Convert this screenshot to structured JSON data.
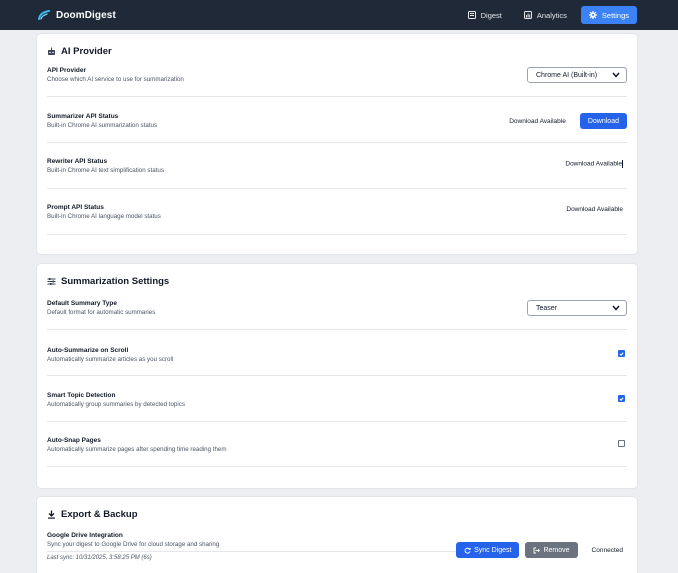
{
  "header": {
    "brand": "DoomDigest",
    "nav": [
      {
        "label": "Digest",
        "icon": "digest-icon"
      },
      {
        "label": "Analytics",
        "icon": "analytics-icon"
      },
      {
        "label": "Settings",
        "icon": "gear-icon",
        "active": true
      }
    ]
  },
  "ai_provider": {
    "title": "AI Provider",
    "icon": "robot-icon",
    "rows": [
      {
        "label": "API Provider",
        "desc": "Choose which AI service to use for summarization",
        "value": "Chrome AI (Built-in)"
      },
      {
        "label": "Summarizer API Status",
        "desc": "Built-in Chrome AI summarization status",
        "status": "Download Available",
        "button": "Download"
      },
      {
        "label": "Rewriter API Status",
        "desc": "Built-in Chrome AI text simplification status",
        "status": "Download Available"
      },
      {
        "label": "Prompt API Status",
        "desc": "Built-in Chrome AI language model status",
        "status": "Download Available"
      }
    ]
  },
  "summarization": {
    "title": "Summarization Settings",
    "icon": "sliders-icon",
    "rows": [
      {
        "label": "Default Summary Type",
        "desc": "Default format for automatic summaries",
        "value": "Teaser"
      },
      {
        "label": "Auto-Summarize on Scroll",
        "desc": "Automatically summarize articles as you scroll",
        "checked": true
      },
      {
        "label": "Smart Topic Detection",
        "desc": "Automatically group summaries by detected topics",
        "checked": true
      },
      {
        "label": "Auto-Snap Pages",
        "desc": "Automatically summarize pages after spending time reading them",
        "checked": false
      }
    ]
  },
  "export": {
    "title": "Export & Backup",
    "icon": "download-icon",
    "drive": {
      "label": "Google Drive Integration",
      "desc": "Sync your digest to Google Drive for cloud storage and sharing",
      "last_sync": "Last sync: 10/31/2025, 3:58:25 PM (6s)",
      "sync_button": "Sync Digest",
      "remove_button": "Remove",
      "status": "Connected"
    }
  },
  "colors": {
    "header_bg": "#1f2937",
    "accent": "#3b82f6",
    "primary": "#2563eb",
    "secondary": "#6b7280"
  }
}
